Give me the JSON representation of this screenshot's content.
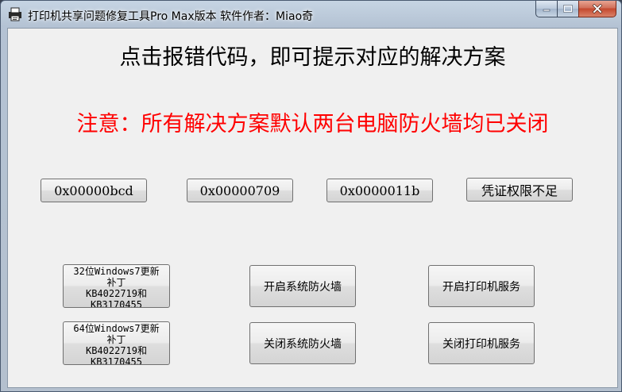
{
  "window": {
    "title": "打印机共享问题修复工具Pro Max版本  软件作者：Miao奇"
  },
  "main": {
    "instruction": "点击报错代码，即可提示对应的解决方案",
    "warning": "注意：所有解决方案默认两台电脑防火墙均已关闭"
  },
  "error_codes": [
    {
      "label": "0x00000bcd"
    },
    {
      "label": "0x00000709"
    },
    {
      "label": "0x0000011b"
    },
    {
      "label": "凭证权限不足"
    }
  ],
  "patch_32": {
    "line1": "32位Windows7更新",
    "line2": "补丁",
    "line3": "KB4022719和",
    "line4": "KB3170455"
  },
  "patch_64": {
    "line1": "64位Windows7更新",
    "line2": "补丁",
    "line3": "KB4022719和",
    "line4": "KB3170455"
  },
  "actions": {
    "enable_firewall": "开启系统防火墙",
    "disable_firewall": "关闭系统防火墙",
    "enable_print_service": "开启打印机服务",
    "disable_print_service": "关闭打印机服务"
  },
  "colors": {
    "warning": "#ff0000",
    "close_button": "#c4482e"
  },
  "icons": [
    "printer-app-icon",
    "minimize-icon",
    "maximize-icon",
    "close-icon"
  ]
}
